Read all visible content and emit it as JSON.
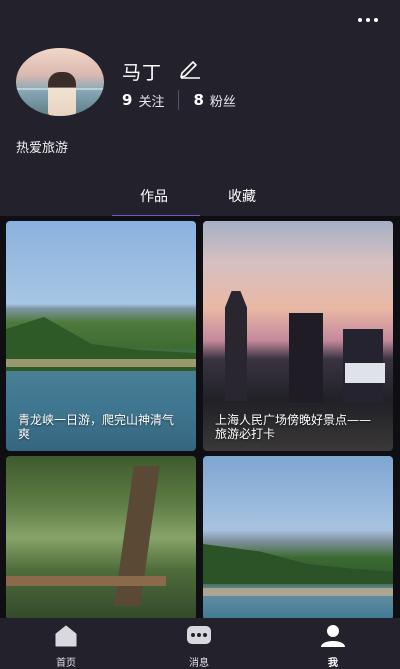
{
  "profile": {
    "name": "马丁",
    "following_count": "9",
    "following_label": "关注",
    "followers_count": "8",
    "followers_label": "粉丝",
    "bio": "热爱旅游"
  },
  "tabs": [
    {
      "label": "作品",
      "active": true
    },
    {
      "label": "收藏",
      "active": false
    }
  ],
  "posts": [
    {
      "caption": "青龙峡一日游，爬完山神清气爽"
    },
    {
      "caption": "上海人民广场傍晚好景点——旅游必打卡"
    },
    {
      "caption": ""
    },
    {
      "caption": ""
    }
  ],
  "bottom_nav": [
    {
      "label": "首页",
      "icon": "home-icon"
    },
    {
      "label": "消息",
      "icon": "message-icon"
    },
    {
      "label": "我",
      "icon": "user-icon"
    }
  ],
  "colors": {
    "background": "#23222c",
    "accent": "#6d57d6",
    "grid_background": "#0f0f13"
  }
}
